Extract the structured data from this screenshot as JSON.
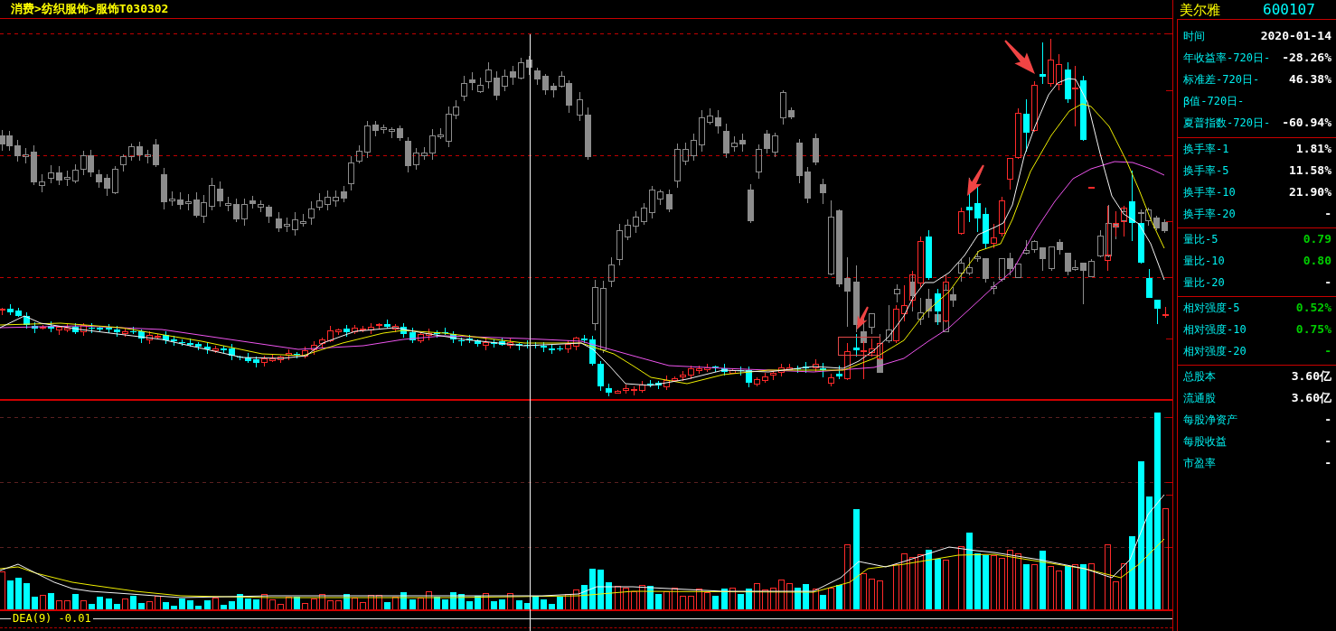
{
  "header": {
    "breadcrumb": "消费>纺织服饰>服饰T030302"
  },
  "macd_strip": {
    "label": "DEA(9) -0.01"
  },
  "quote_panel": {
    "name": "美尔雅",
    "code": "600107",
    "sections": [
      {
        "rows": [
          {
            "label": "时间",
            "value": "2020-01-14",
            "color": "#ffffff"
          },
          {
            "label": "年收益率-720日-",
            "value": "-28.26%",
            "color": "#ffffff"
          },
          {
            "label": "标准差-720日-",
            "value": "46.38%",
            "color": "#ffffff"
          },
          {
            "label": "β值-720日-"
          },
          {
            "label": "夏普指数-720日-",
            "value": "-60.94%",
            "color": "#ffffff"
          }
        ]
      },
      {
        "rows": [
          {
            "label": "换手率-1",
            "value": "1.81%",
            "color": "#ffffff"
          },
          {
            "label": "换手率-5",
            "value": "11.58%",
            "color": "#ffffff"
          },
          {
            "label": "换手率-10",
            "value": "21.90%",
            "color": "#ffffff"
          },
          {
            "label": "换手率-20",
            "value": "-",
            "color": "#ffffff"
          }
        ]
      },
      {
        "rows": [
          {
            "label": "量比-5",
            "value": "0.79",
            "color": "#00cc00"
          },
          {
            "label": "量比-10",
            "value": "0.80",
            "color": "#00cc00"
          },
          {
            "label": "量比-20",
            "value": "-",
            "color": "#ffffff"
          }
        ]
      },
      {
        "rows": [
          {
            "label": "相对强度-5",
            "value": "0.52%",
            "color": "#00cc00"
          },
          {
            "label": "相对强度-10",
            "value": "0.75%",
            "color": "#00cc00"
          },
          {
            "label": "相对强度-20",
            "value": "-",
            "color": "#00cc00"
          }
        ]
      },
      {
        "rows": [
          {
            "label": "总股本",
            "value": "3.60亿",
            "color": "#ffffff"
          },
          {
            "label": "流通股",
            "value": "3.60亿",
            "color": "#ffffff"
          },
          {
            "label": "每股净资产",
            "value": "-",
            "color": "#ffffff"
          },
          {
            "label": "每股收益",
            "value": "-",
            "color": "#ffffff"
          },
          {
            "label": "市盈率",
            "value": "-",
            "color": "#ffffff"
          }
        ]
      }
    ]
  }
}
